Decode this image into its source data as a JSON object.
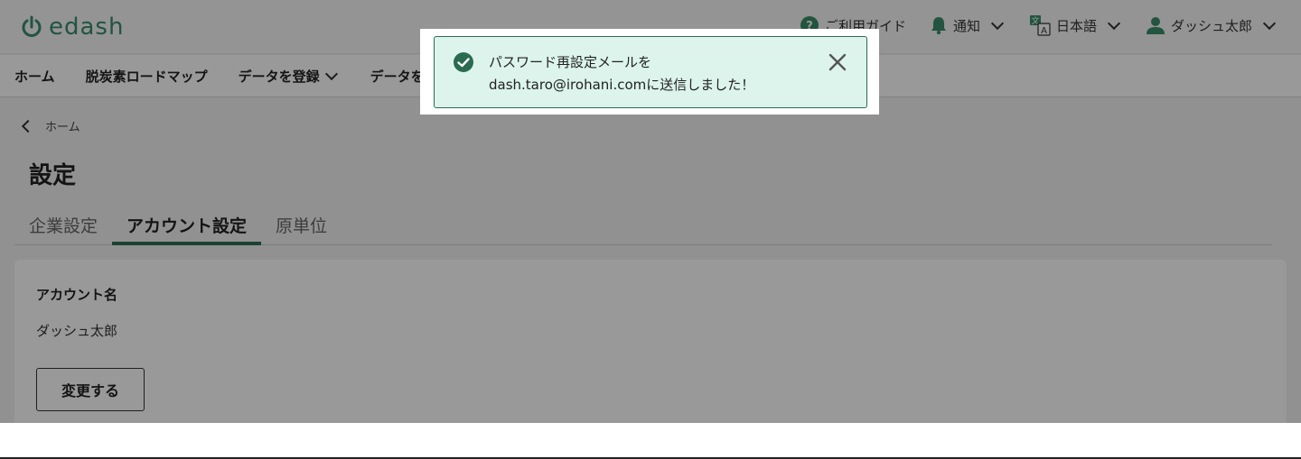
{
  "brand": {
    "name": "edash",
    "color": "#3a8d6c"
  },
  "header": {
    "guide_label": "ご利用ガイド",
    "notify_label": "通知",
    "language_label": "日本語",
    "user_name": "ダッシュ太郎"
  },
  "nav": {
    "items": [
      "ホーム",
      "脱炭素ロードマップ",
      "データを登録",
      "データを"
    ]
  },
  "breadcrumb": {
    "back_label": "ホーム"
  },
  "page": {
    "title": "設定"
  },
  "tabs": [
    "企業設定",
    "アカウント設定",
    "原単位"
  ],
  "account": {
    "label": "アカウント名",
    "value": "ダッシュ太郎",
    "change_button": "変更する"
  },
  "toast": {
    "line1": "パスワード再設定メールを",
    "line2": "dash.taro@irohani.comに送信しました！",
    "accent": "#2b6b52",
    "background": "#dcf4ec"
  },
  "icons": {
    "logo": "power-icon",
    "guide": "help-circle-icon",
    "notify": "bell-icon",
    "language": "translate-icon",
    "user": "user-icon",
    "success": "check-circle-icon",
    "close": "close-icon"
  }
}
